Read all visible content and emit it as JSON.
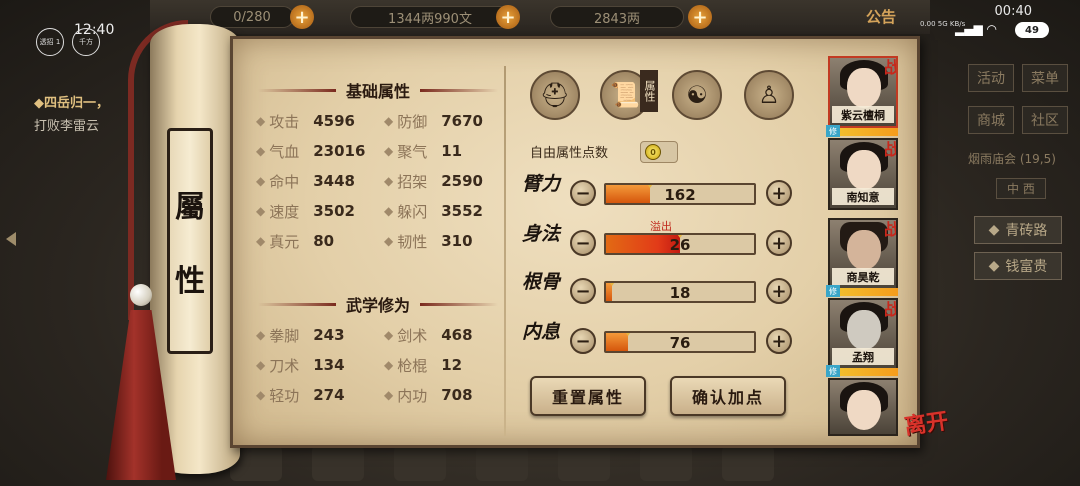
{
  "topbar": {
    "res1_value": "0/280",
    "res2_value": "1344两990文",
    "res3_value": "2843两",
    "notice_label": "公告",
    "plus_symbol": "+"
  },
  "status": {
    "phone_time": "12:40",
    "clock": "00:40",
    "net_speed": "0.00 5G KB/s",
    "signal": "▂▄▆ ◠",
    "battery": "49",
    "left_btn1": "透招 1",
    "left_btn2": "千方"
  },
  "quest": {
    "title": "◆四岳归一，",
    "desc": "打败李雷云"
  },
  "scroll": {
    "char1": "屬",
    "char2": "性"
  },
  "basic": {
    "title": "基础属性",
    "stats": [
      {
        "label": "攻击",
        "value": "4596"
      },
      {
        "label": "防御",
        "value": "7670"
      },
      {
        "label": "气血",
        "value": "23016"
      },
      {
        "label": "聚气",
        "value": "11"
      },
      {
        "label": "命中",
        "value": "3448"
      },
      {
        "label": "招架",
        "value": "2590"
      },
      {
        "label": "速度",
        "value": "3502"
      },
      {
        "label": "躲闪",
        "value": "3552"
      },
      {
        "label": "真元",
        "value": "80"
      },
      {
        "label": "韧性",
        "value": "310"
      }
    ]
  },
  "martial": {
    "title": "武学修为",
    "stats": [
      {
        "label": "拳脚",
        "value": "243"
      },
      {
        "label": "剑术",
        "value": "468"
      },
      {
        "label": "刀术",
        "value": "134"
      },
      {
        "label": "枪棍",
        "value": "12"
      },
      {
        "label": "轻功",
        "value": "274"
      },
      {
        "label": "内功",
        "value": "708"
      }
    ]
  },
  "tabs": {
    "active_tag": "属性",
    "icons": [
      "hat-icon",
      "scroll-icon",
      "bagua-icon",
      "figure-icon"
    ]
  },
  "free_points": {
    "label": "自由属性点数",
    "value": "0"
  },
  "attributes": [
    {
      "name": "臂力",
      "value": "162",
      "fill": 0.3,
      "overflow": false
    },
    {
      "name": "身法",
      "value": "26",
      "fill": 0.5,
      "overflow": true
    },
    {
      "name": "根骨",
      "value": "18",
      "fill": 0.04,
      "overflow": false
    },
    {
      "name": "内息",
      "value": "76",
      "fill": 0.15,
      "overflow": false
    }
  ],
  "overflow_label": "溢出",
  "minus_symbol": "−",
  "plus_symbol": "+",
  "buttons": {
    "reset": "重置属性",
    "confirm": "确认加点"
  },
  "characters": [
    {
      "name": "紫云檀桐",
      "tag": "战",
      "active": true
    },
    {
      "name": "南知意",
      "tag": "战",
      "active": false
    },
    {
      "name": "商昊乾",
      "tag": "战",
      "active": false
    },
    {
      "name": "孟翔",
      "tag": "战",
      "active": false
    },
    {
      "name": "",
      "tag": "",
      "active": false
    }
  ],
  "repair_tag": "修",
  "leave_label": "离开",
  "right_menu": {
    "activity": "活动",
    "menu": "菜单",
    "shop": "商城",
    "community": "社区",
    "location": "烟雨庙会",
    "location_coord": "(19,5)",
    "compass": "中 西",
    "road1": "青砖路",
    "road2": "钱富贵"
  },
  "colors": {
    "accent": "#c23a22",
    "bar_fill": "#e8701c",
    "parchment": "#e8d6b0"
  }
}
